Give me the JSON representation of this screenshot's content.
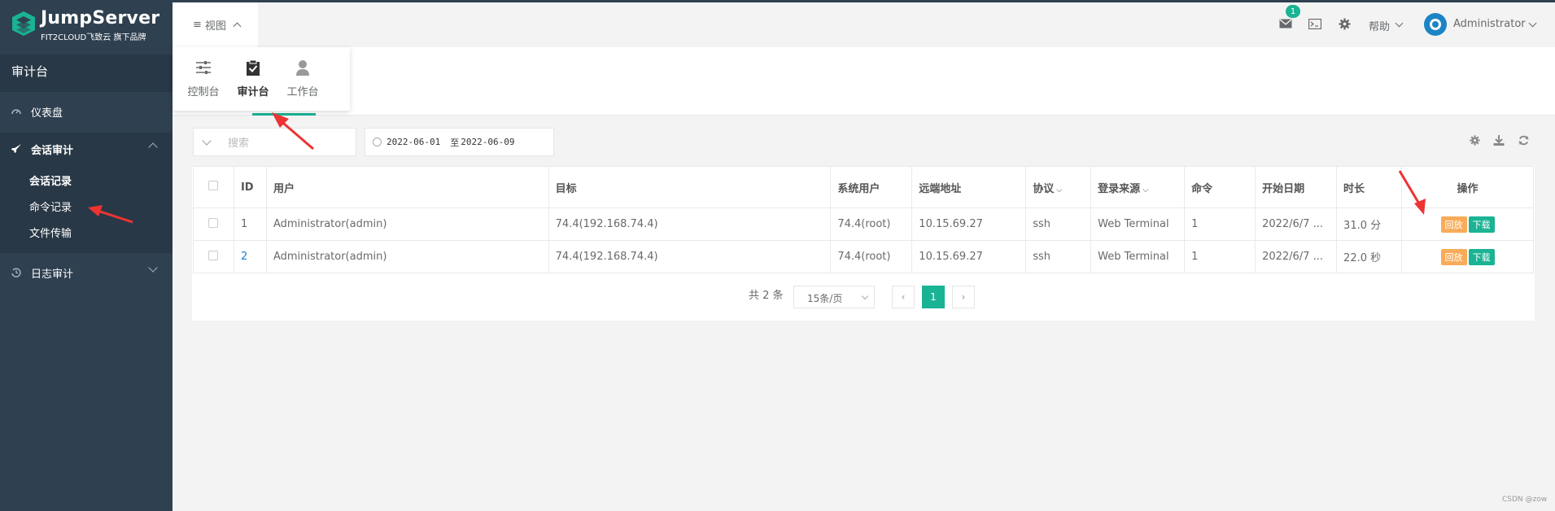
{
  "brand": {
    "name": "JumpServer",
    "sub": "FIT2CLOUD飞致云 旗下品牌"
  },
  "sidebar": {
    "header": "审计台",
    "dashboard": "仪表盘",
    "session_audit": "会话审计",
    "sub_items": [
      "会话记录",
      "命令记录",
      "文件传输"
    ],
    "log_audit": "日志审计"
  },
  "topbar": {
    "view_label": "视图",
    "badge_count": "1",
    "help": "帮助",
    "user": "Administrator"
  },
  "view_menu": [
    {
      "label": "控制台",
      "icon": "sliders-icon"
    },
    {
      "label": "审计台",
      "icon": "clipboard-check-icon"
    },
    {
      "label": "工作台",
      "icon": "user-icon"
    }
  ],
  "filters": {
    "search_placeholder": "搜索",
    "date_start": "2022-06-01",
    "date_to": "至",
    "date_end": "2022-06-09"
  },
  "table": {
    "headers": [
      "ID",
      "用户",
      "目标",
      "系统用户",
      "远端地址",
      "协议",
      "登录来源",
      "命令",
      "开始日期",
      "时长",
      "操作"
    ],
    "rows": [
      {
        "id": "1",
        "user": "Administrator(admin)",
        "target": "74.4(192.168.74.4)",
        "sys_user": "74.4(root)",
        "remote": "10.15.69.27",
        "protocol": "ssh",
        "source": "Web Terminal",
        "commands": "1",
        "start": "2022/6/7 ...",
        "duration": "31.0 分"
      },
      {
        "id": "2",
        "user": "Administrator(admin)",
        "target": "74.4(192.168.74.4)",
        "sys_user": "74.4(root)",
        "remote": "10.15.69.27",
        "protocol": "ssh",
        "source": "Web Terminal",
        "commands": "1",
        "start": "2022/6/7 ...",
        "duration": "22.0 秒"
      }
    ],
    "replay_label": "回放",
    "download_label": "下载"
  },
  "pagination": {
    "total": "共 2 条",
    "page_size": "15条/页",
    "current": "1"
  },
  "watermark": "CSDN @zow",
  "colors": {
    "sidebar": "#2f4050",
    "accent": "#1ab394",
    "replay": "#f8ac59",
    "arrow": "#ee3333"
  }
}
